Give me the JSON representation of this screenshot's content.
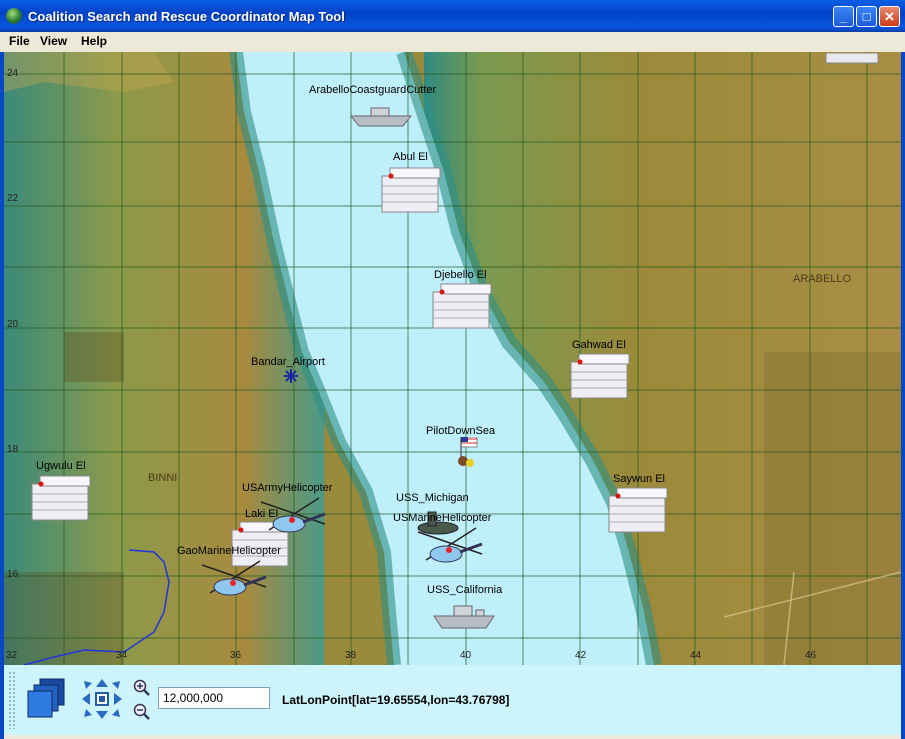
{
  "window": {
    "title": "Coalition Search and Rescue Coordinator Map Tool",
    "minimize_label": "_",
    "maximize_label": "□",
    "close_label": "✕"
  },
  "menu": {
    "items": [
      "File",
      "View",
      "Help"
    ]
  },
  "map": {
    "colors": {
      "water": "#bfeffa",
      "land": "#9c8838",
      "grid": "#1f5a20",
      "route": "#2233dd"
    },
    "lat_labels": [
      "24",
      "22",
      "20",
      "18",
      "16"
    ],
    "lon_labels": [
      "32",
      "34",
      "36",
      "38",
      "40",
      "42",
      "44",
      "46"
    ],
    "regions": [
      "ARABELLO",
      "BINNI"
    ],
    "objects": {
      "cutter": "ArabelloCoastguardCutter",
      "abul": "Abul El",
      "djebello": "Djebello El",
      "gahwad": "Gahwad El",
      "airport": "Bandar_Airport",
      "pilot": "PilotDownSea",
      "ugwulu": "Ugwulu El",
      "saywun": "Saywun El",
      "army_heli": "USArmyHelicopter",
      "laki": "Laki El",
      "michigan": "USS_Michigan",
      "marine_heli": "USMarineHelicopter",
      "gao_heli": "GaoMarineHelicopter",
      "california": "USS_California"
    }
  },
  "toolbar": {
    "scale_value": "12,000,000",
    "latlon_text": "LatLonPoint[lat=19.65554,lon=43.76798]",
    "icons": [
      "layers-icon",
      "pan-arrows-icon",
      "zoom-in-icon",
      "zoom-out-icon"
    ]
  }
}
